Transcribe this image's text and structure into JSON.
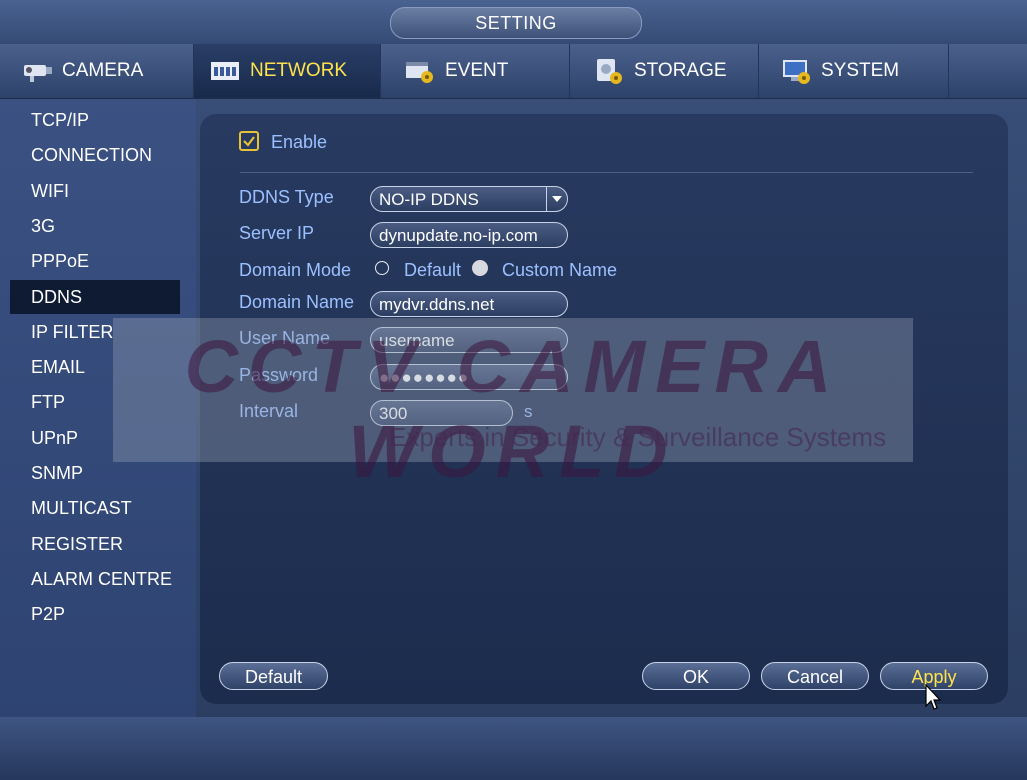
{
  "window": {
    "title": "SETTING"
  },
  "tabs": [
    {
      "label": "CAMERA",
      "icon": "camera-icon",
      "active": false
    },
    {
      "label": "NETWORK",
      "icon": "network-icon",
      "active": true
    },
    {
      "label": "EVENT",
      "icon": "event-icon",
      "active": false
    },
    {
      "label": "STORAGE",
      "icon": "storage-icon",
      "active": false
    },
    {
      "label": "SYSTEM",
      "icon": "system-icon",
      "active": false
    }
  ],
  "sidebar": {
    "items": [
      {
        "label": "TCP/IP"
      },
      {
        "label": "CONNECTION"
      },
      {
        "label": "WIFI"
      },
      {
        "label": "3G"
      },
      {
        "label": "PPPoE"
      },
      {
        "label": "DDNS",
        "active": true
      },
      {
        "label": "IP FILTER"
      },
      {
        "label": "EMAIL"
      },
      {
        "label": "FTP"
      },
      {
        "label": "UPnP"
      },
      {
        "label": "SNMP"
      },
      {
        "label": "MULTICAST"
      },
      {
        "label": "REGISTER"
      },
      {
        "label": "ALARM CENTRE"
      },
      {
        "label": "P2P"
      }
    ]
  },
  "form": {
    "enable_label": "Enable",
    "enable_checked": true,
    "ddns_type_label": "DDNS Type",
    "ddns_type_value": "NO-IP DDNS",
    "server_ip_label": "Server IP",
    "server_ip_value": "dynupdate.no-ip.com",
    "domain_mode_label": "Domain Mode",
    "domain_mode_options": [
      "Default",
      "Custom Name"
    ],
    "domain_mode_selected": "Custom Name",
    "domain_name_label": "Domain Name",
    "domain_name_value": "mydvr.ddns.net",
    "user_name_label": "User Name",
    "user_name_value": "username",
    "password_label": "Password",
    "password_value": "●●●●●●●●",
    "interval_label": "Interval",
    "interval_value": "300",
    "interval_unit": "s"
  },
  "buttons": {
    "default": "Default",
    "ok": "OK",
    "cancel": "Cancel",
    "apply": "Apply"
  },
  "watermark": {
    "brand": "CCTV CAMERA WORLD",
    "tagline": "Experts in Security & Surveillance Systems"
  },
  "colors": {
    "label": "#9cc0ff",
    "active_tab_text": "#ffe34d",
    "apply_text": "#ffe34d"
  }
}
